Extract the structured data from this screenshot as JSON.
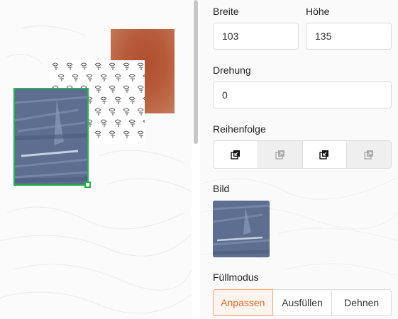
{
  "properties": {
    "width_label": "Breite",
    "width_value": "103",
    "height_label": "Höhe",
    "height_value": "135",
    "rotation_label": "Drehung",
    "rotation_value": "0",
    "order_label": "Reihenfolge",
    "order_buttons": [
      {
        "icon": "bring-forward-icon",
        "enabled": true
      },
      {
        "icon": "bring-to-front-icon",
        "enabled": false
      },
      {
        "icon": "send-backward-icon",
        "enabled": true
      },
      {
        "icon": "send-to-back-icon",
        "enabled": false
      }
    ],
    "image_label": "Bild",
    "fill_label": "Füllmodus",
    "fill_options": [
      "Anpassen",
      "Ausfüllen",
      "Dehnen"
    ],
    "fill_selected": "Anpassen"
  },
  "colors": {
    "selection": "#22b14c",
    "accent": "#e06a2c",
    "accent_bg": "#fff5ee",
    "accent_border": "#f0a47a"
  }
}
